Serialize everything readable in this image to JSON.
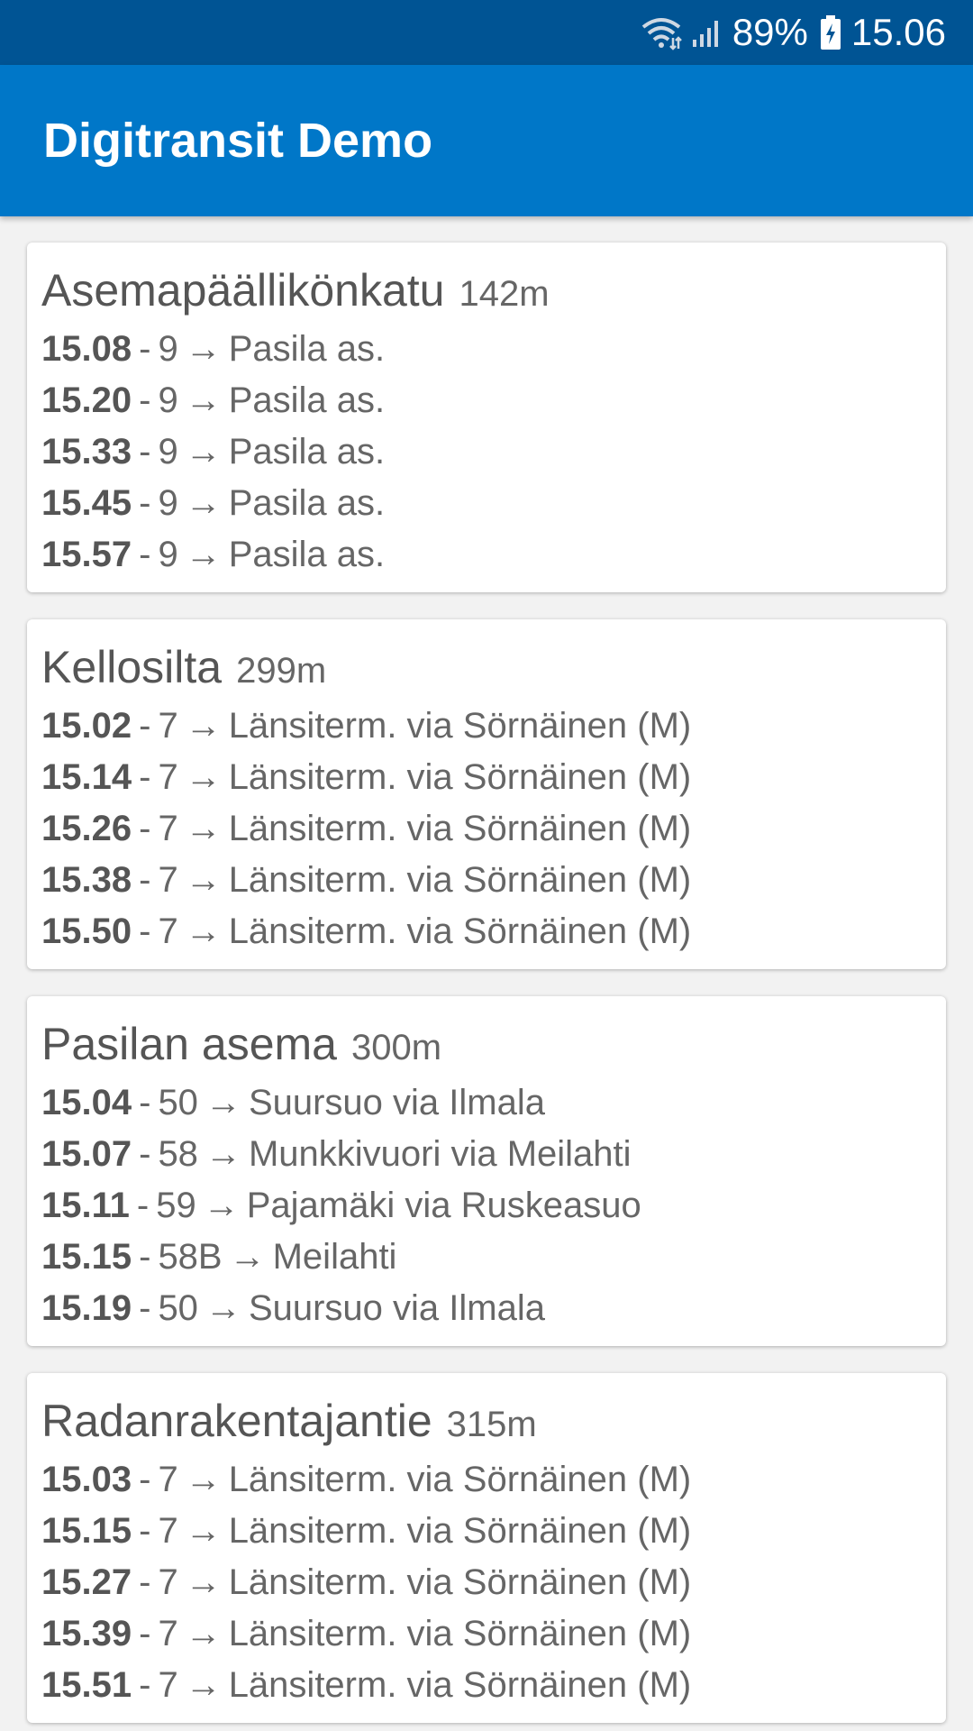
{
  "status_bar": {
    "battery": "89%",
    "time": "15.06",
    "icons": [
      "wifi-icon",
      "signal-icon",
      "battery-charging-icon"
    ]
  },
  "app_bar": {
    "title": "Digitransit Demo",
    "color": "#0077c8"
  },
  "colors": {
    "status_bar": "#005494",
    "background": "#f2f2f2",
    "card": "#ffffff",
    "text": "#555555"
  },
  "stops": [
    {
      "name": "Asemapäällikönkatu",
      "distance": "142m",
      "departures": [
        {
          "time": "15.08",
          "sep": "-",
          "route": "9",
          "arrow": "→",
          "destination": "Pasila as."
        },
        {
          "time": "15.20",
          "sep": "-",
          "route": "9",
          "arrow": "→",
          "destination": "Pasila as."
        },
        {
          "time": "15.33",
          "sep": "-",
          "route": "9",
          "arrow": "→",
          "destination": "Pasila as."
        },
        {
          "time": "15.45",
          "sep": "-",
          "route": "9",
          "arrow": "→",
          "destination": "Pasila as."
        },
        {
          "time": "15.57",
          "sep": "-",
          "route": "9",
          "arrow": "→",
          "destination": "Pasila as."
        }
      ]
    },
    {
      "name": "Kellosilta",
      "distance": "299m",
      "departures": [
        {
          "time": "15.02",
          "sep": "-",
          "route": "7",
          "arrow": "→",
          "destination": "Länsiterm. via Sörnäinen (M)"
        },
        {
          "time": "15.14",
          "sep": "-",
          "route": "7",
          "arrow": "→",
          "destination": "Länsiterm. via Sörnäinen (M)"
        },
        {
          "time": "15.26",
          "sep": "-",
          "route": "7",
          "arrow": "→",
          "destination": "Länsiterm. via Sörnäinen (M)"
        },
        {
          "time": "15.38",
          "sep": "-",
          "route": "7",
          "arrow": "→",
          "destination": "Länsiterm. via Sörnäinen (M)"
        },
        {
          "time": "15.50",
          "sep": "-",
          "route": "7",
          "arrow": "→",
          "destination": "Länsiterm. via Sörnäinen (M)"
        }
      ]
    },
    {
      "name": "Pasilan asema",
      "distance": "300m",
      "departures": [
        {
          "time": "15.04",
          "sep": "-",
          "route": "50",
          "arrow": "→",
          "destination": "Suursuo via Ilmala"
        },
        {
          "time": "15.07",
          "sep": "-",
          "route": "58",
          "arrow": "→",
          "destination": "Munkkivuori via Meilahti"
        },
        {
          "time": "15.11",
          "sep": "-",
          "route": "59",
          "arrow": "→",
          "destination": "Pajamäki via Ruskeasuo"
        },
        {
          "time": "15.15",
          "sep": "-",
          "route": "58B",
          "arrow": "→",
          "destination": "Meilahti"
        },
        {
          "time": "15.19",
          "sep": "-",
          "route": "50",
          "arrow": "→",
          "destination": "Suursuo via Ilmala"
        }
      ]
    },
    {
      "name": "Radanrakentajantie",
      "distance": "315m",
      "departures": [
        {
          "time": "15.03",
          "sep": "-",
          "route": "7",
          "arrow": "→",
          "destination": "Länsiterm. via Sörnäinen (M)"
        },
        {
          "time": "15.15",
          "sep": "-",
          "route": "7",
          "arrow": "→",
          "destination": "Länsiterm. via Sörnäinen (M)"
        },
        {
          "time": "15.27",
          "sep": "-",
          "route": "7",
          "arrow": "→",
          "destination": "Länsiterm. via Sörnäinen (M)"
        },
        {
          "time": "15.39",
          "sep": "-",
          "route": "7",
          "arrow": "→",
          "destination": "Länsiterm. via Sörnäinen (M)"
        },
        {
          "time": "15.51",
          "sep": "-",
          "route": "7",
          "arrow": "→",
          "destination": "Länsiterm. via Sörnäinen (M)"
        }
      ]
    }
  ]
}
